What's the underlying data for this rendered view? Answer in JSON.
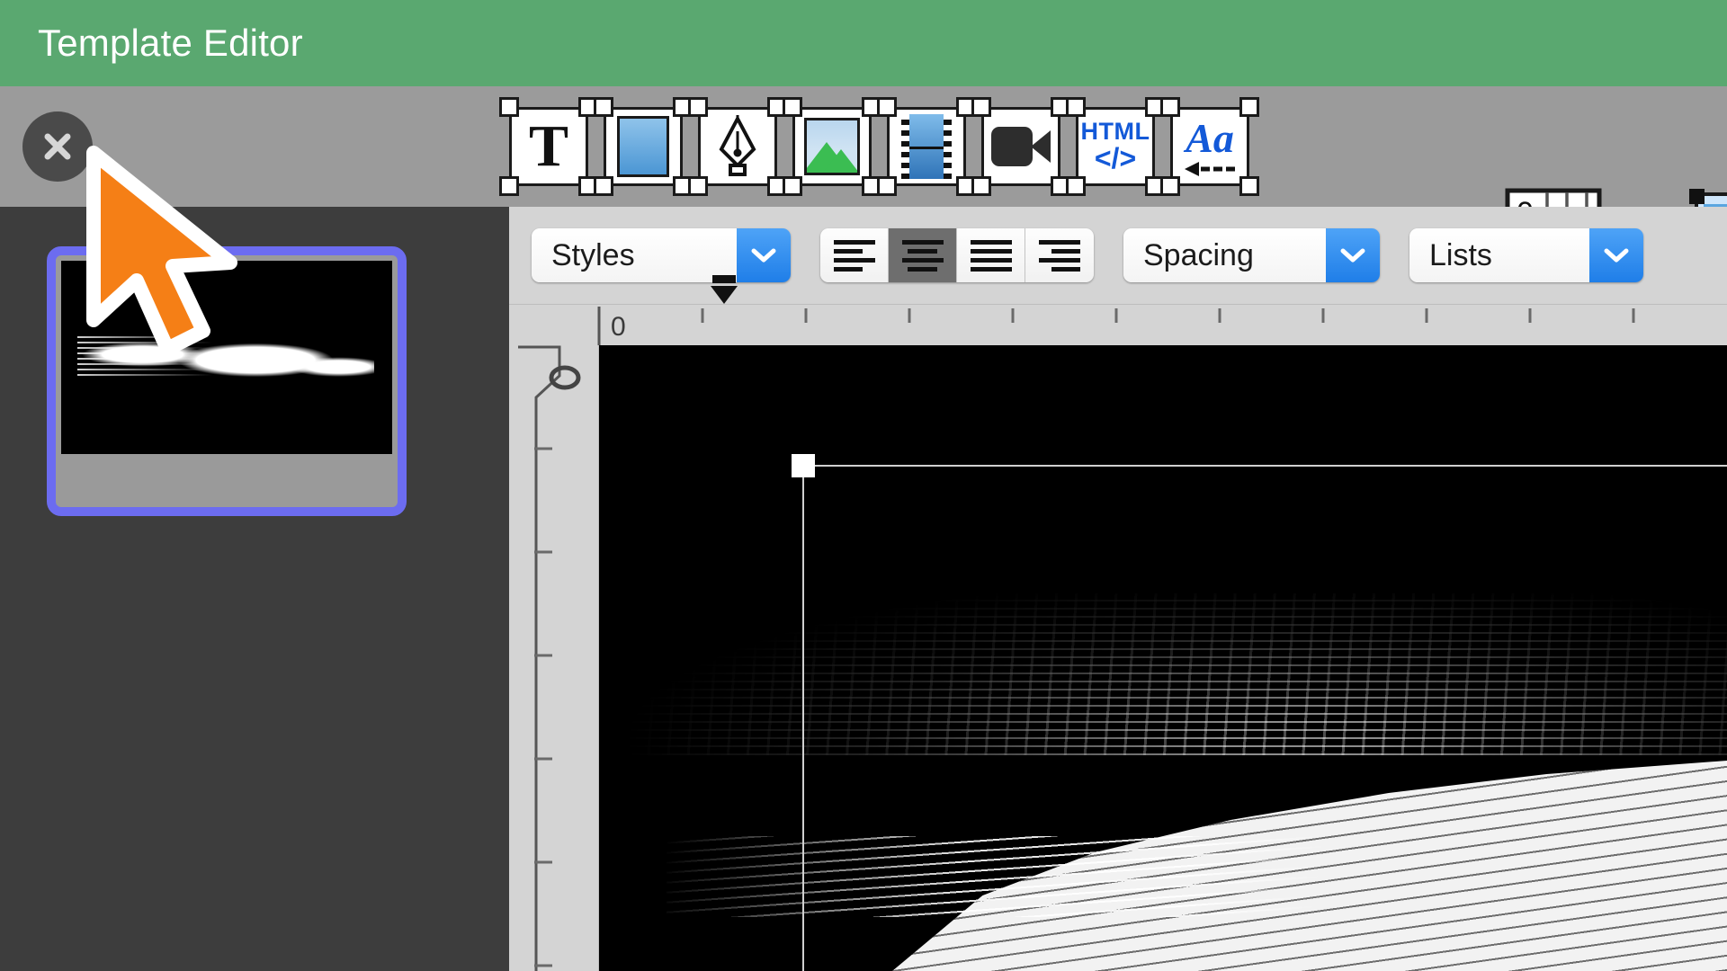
{
  "window": {
    "title": "Template Editor",
    "title_bar_color": "#5aa870",
    "toolbar_bg": "#9b9b9b",
    "sidebar_bg": "#3d3d3d",
    "editor_bg": "#d4d4d4",
    "accent_blue": "#1f7ee8",
    "selection_border": "#6c6cf0",
    "cursor_color": "#f57f16"
  },
  "titlebar": {
    "close_label": "close-icon"
  },
  "toolbar": {
    "items": [
      {
        "name": "insert-text-box",
        "icon": "text-t-icon",
        "label": "T"
      },
      {
        "name": "insert-shape",
        "icon": "blue-rectangle-icon",
        "label": ""
      },
      {
        "name": "insert-drawing",
        "icon": "pen-nib-icon",
        "label": ""
      },
      {
        "name": "insert-image",
        "icon": "photo-icon",
        "label": ""
      },
      {
        "name": "insert-film",
        "icon": "film-strip-icon",
        "label": ""
      },
      {
        "name": "insert-video",
        "icon": "video-camera-icon",
        "label": ""
      },
      {
        "name": "insert-html",
        "icon": "html-code-icon",
        "label_top": "HTML",
        "label_bottom": "</>"
      },
      {
        "name": "insert-text-wrap",
        "icon": "aa-text-wrap-icon",
        "label": "Aa"
      }
    ],
    "ruler_tool": {
      "name": "ruler-tool",
      "zero_label": "0"
    },
    "document_tool": {
      "name": "document-outline-tool"
    }
  },
  "sidebar": {
    "pages": [
      {
        "name": "page-thumbnail-1",
        "selected": true
      }
    ]
  },
  "format_bar": {
    "styles": {
      "label": "Styles",
      "chevron": "chevron-down-icon"
    },
    "alignment": {
      "buttons": [
        {
          "name": "align-left",
          "icon": "align-left-icon",
          "active": false
        },
        {
          "name": "align-center",
          "icon": "align-center-icon",
          "active": true
        },
        {
          "name": "align-justify",
          "icon": "align-justify-icon",
          "active": false
        },
        {
          "name": "align-right",
          "icon": "align-right-icon",
          "active": false
        }
      ]
    },
    "spacing": {
      "label": "Spacing",
      "chevron": "chevron-down-icon"
    },
    "lists": {
      "label": "Lists",
      "chevron": "chevron-down-icon"
    }
  },
  "rulers": {
    "horizontal_zero": "0",
    "indent_marker": "indent-marker"
  },
  "canvas": {
    "object": {
      "name": "selected-text-object",
      "handle": "resize-handle"
    }
  }
}
